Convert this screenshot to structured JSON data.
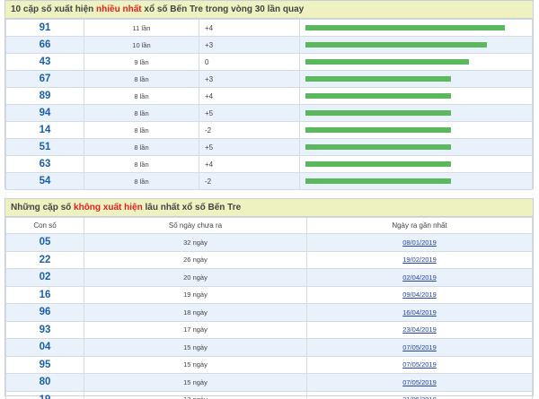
{
  "top_panel": {
    "title_pre": "10 cặp số xuất hiện ",
    "title_highlight": "nhiều nhất",
    "title_post": " xổ số Bến Tre trong vòng 30 lần quay",
    "rows": [
      {
        "number": "91",
        "count": "11 lần",
        "diff": "+4",
        "bar_fraction": 1.0
      },
      {
        "number": "66",
        "count": "10 lần",
        "diff": "+3",
        "bar_fraction": 0.91
      },
      {
        "number": "43",
        "count": "9 lần",
        "diff": "0",
        "bar_fraction": 0.82
      },
      {
        "number": "67",
        "count": "8 lần",
        "diff": "+3",
        "bar_fraction": 0.73
      },
      {
        "number": "89",
        "count": "8 lần",
        "diff": "+4",
        "bar_fraction": 0.73
      },
      {
        "number": "94",
        "count": "8 lần",
        "diff": "+5",
        "bar_fraction": 0.73
      },
      {
        "number": "14",
        "count": "8 lần",
        "diff": "-2",
        "bar_fraction": 0.73
      },
      {
        "number": "51",
        "count": "8 lần",
        "diff": "+5",
        "bar_fraction": 0.73
      },
      {
        "number": "63",
        "count": "8 lần",
        "diff": "+4",
        "bar_fraction": 0.73
      },
      {
        "number": "54",
        "count": "8 lần",
        "diff": "-2",
        "bar_fraction": 0.73
      }
    ]
  },
  "bottom_panel": {
    "title_pre": "Những cặp số ",
    "title_highlight": "không xuất hiện",
    "title_post": " lâu nhất xổ số Bến Tre",
    "headers": {
      "number": "Con số",
      "days": "Số ngày chưa ra",
      "date": "Ngày ra gần nhất"
    },
    "rows": [
      {
        "number": "05",
        "days": "32 ngày",
        "date": "08/01/2019"
      },
      {
        "number": "22",
        "days": "26 ngày",
        "date": "19/02/2019"
      },
      {
        "number": "02",
        "days": "20 ngày",
        "date": "02/04/2019"
      },
      {
        "number": "16",
        "days": "19 ngày",
        "date": "09/04/2019"
      },
      {
        "number": "96",
        "days": "18 ngày",
        "date": "16/04/2019"
      },
      {
        "number": "93",
        "days": "17 ngày",
        "date": "23/04/2019"
      },
      {
        "number": "04",
        "days": "15 ngày",
        "date": "07/05/2019"
      },
      {
        "number": "95",
        "days": "15 ngày",
        "date": "07/05/2019"
      },
      {
        "number": "80",
        "days": "15 ngày",
        "date": "07/05/2019"
      },
      {
        "number": "19",
        "days": "13 ngày",
        "date": "21/05/2019"
      }
    ]
  },
  "colors": {
    "bar": "#5cb85c",
    "highlight": "#e02222",
    "number": "#1a5fa8",
    "title_bg": "#eef1c0"
  }
}
